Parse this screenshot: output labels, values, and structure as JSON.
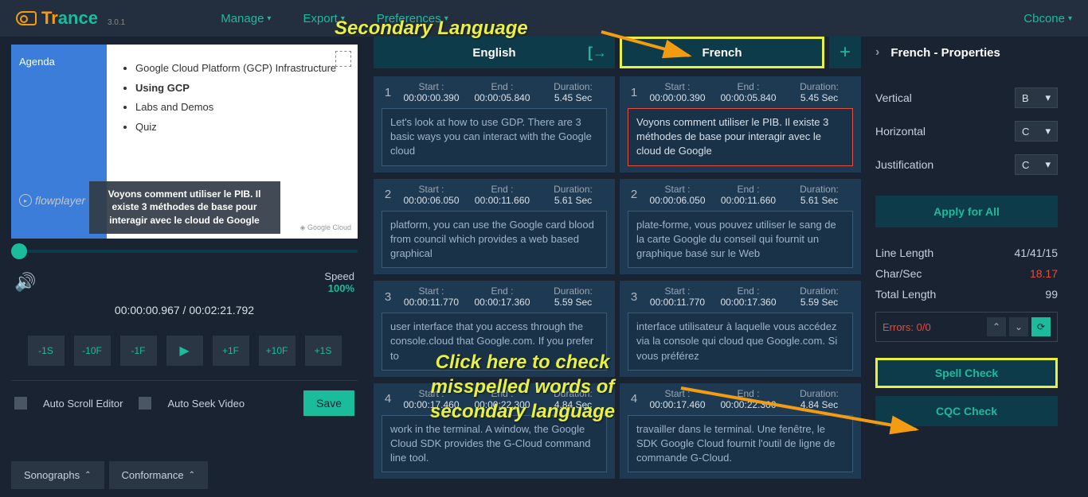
{
  "app": {
    "version": "3.0.1",
    "user": "Cbcone"
  },
  "menu": [
    "Manage",
    "Export",
    "Preferences"
  ],
  "video": {
    "agenda_title": "Agenda",
    "bullets": [
      "Google Cloud Platform (GCP) Infrastructure",
      "Using GCP",
      "Labs and Demos",
      "Quiz"
    ],
    "caption": "Voyons comment utiliser le PIB. Il existe 3 méthodes de base pour interagir avec le cloud de Google",
    "timecode": "00:00:00.967 / 00:02:21.792",
    "speed_label": "Speed",
    "speed_value": "100%"
  },
  "nav_buttons": [
    "-1S",
    "-10F",
    "-1F",
    "▶",
    "+1F",
    "+10F",
    "+1S"
  ],
  "auto": {
    "scroll": "Auto Scroll Editor",
    "seek": "Auto Seek Video",
    "save": "Save"
  },
  "bottom_tabs": [
    "Sonographs",
    "Conformance"
  ],
  "columns": {
    "english": {
      "title": "English"
    },
    "french": {
      "title": "French"
    }
  },
  "cue_labels": {
    "start": "Start :",
    "end": "End :",
    "duration": "Duration:"
  },
  "cues_en": [
    {
      "n": "1",
      "start": "00:00:00.390",
      "end": "00:00:05.840",
      "dur": "5.45 Sec",
      "text": "Let's look at how to use GDP. There are 3 basic ways you can interact with the Google cloud"
    },
    {
      "n": "2",
      "start": "00:00:06.050",
      "end": "00:00:11.660",
      "dur": "5.61 Sec",
      "text": "platform, you can use the Google card blood from council which provides a web based graphical"
    },
    {
      "n": "3",
      "start": "00:00:11.770",
      "end": "00:00:17.360",
      "dur": "5.59 Sec",
      "text": "user interface that you access through the console.cloud that Google.com. If you prefer to"
    },
    {
      "n": "4",
      "start": "00:00:17.460",
      "end": "00:00:22.300",
      "dur": "4.84 Sec",
      "text": "work in the terminal. A window, the Google Cloud SDK provides the G-Cloud command line tool."
    }
  ],
  "cues_fr": [
    {
      "n": "1",
      "start": "00:00:00.390",
      "end": "00:00:05.840",
      "dur": "5.45 Sec",
      "text": "Voyons comment utiliser le PIB. Il existe 3 méthodes de base pour interagir avec le cloud de Google",
      "selected": true
    },
    {
      "n": "2",
      "start": "00:00:06.050",
      "end": "00:00:11.660",
      "dur": "5.61 Sec",
      "text": "plate-forme, vous pouvez utiliser le sang de la carte Google du conseil qui fournit un graphique basé sur le Web"
    },
    {
      "n": "3",
      "start": "00:00:11.770",
      "end": "00:00:17.360",
      "dur": "5.59 Sec",
      "text": "interface utilisateur à laquelle vous accédez via la console qui cloud que Google.com. Si vous préférez"
    },
    {
      "n": "4",
      "start": "00:00:17.460",
      "end": "00:00:22.300",
      "dur": "4.84 Sec",
      "text": "travailler dans le terminal. Une fenêtre, le SDK Google Cloud fournit l'outil de ligne de commande G-Cloud."
    }
  ],
  "props": {
    "title": "French - Properties",
    "vertical": {
      "label": "Vertical",
      "value": "B"
    },
    "horizontal": {
      "label": "Horizontal",
      "value": "C"
    },
    "justification": {
      "label": "Justification",
      "value": "C"
    },
    "apply": "Apply for All",
    "line_length": {
      "label": "Line Length",
      "value": "41/41/15"
    },
    "char_sec": {
      "label": "Char/Sec",
      "value": "18.17"
    },
    "total_length": {
      "label": "Total Length",
      "value": "99"
    },
    "errors": "Errors: 0/0",
    "spell": "Spell Check",
    "cqc": "CQC Check"
  },
  "annotations": {
    "secondary": "Secondary Language",
    "spellcheck": "Click here to check misspelled words of secondary language"
  }
}
